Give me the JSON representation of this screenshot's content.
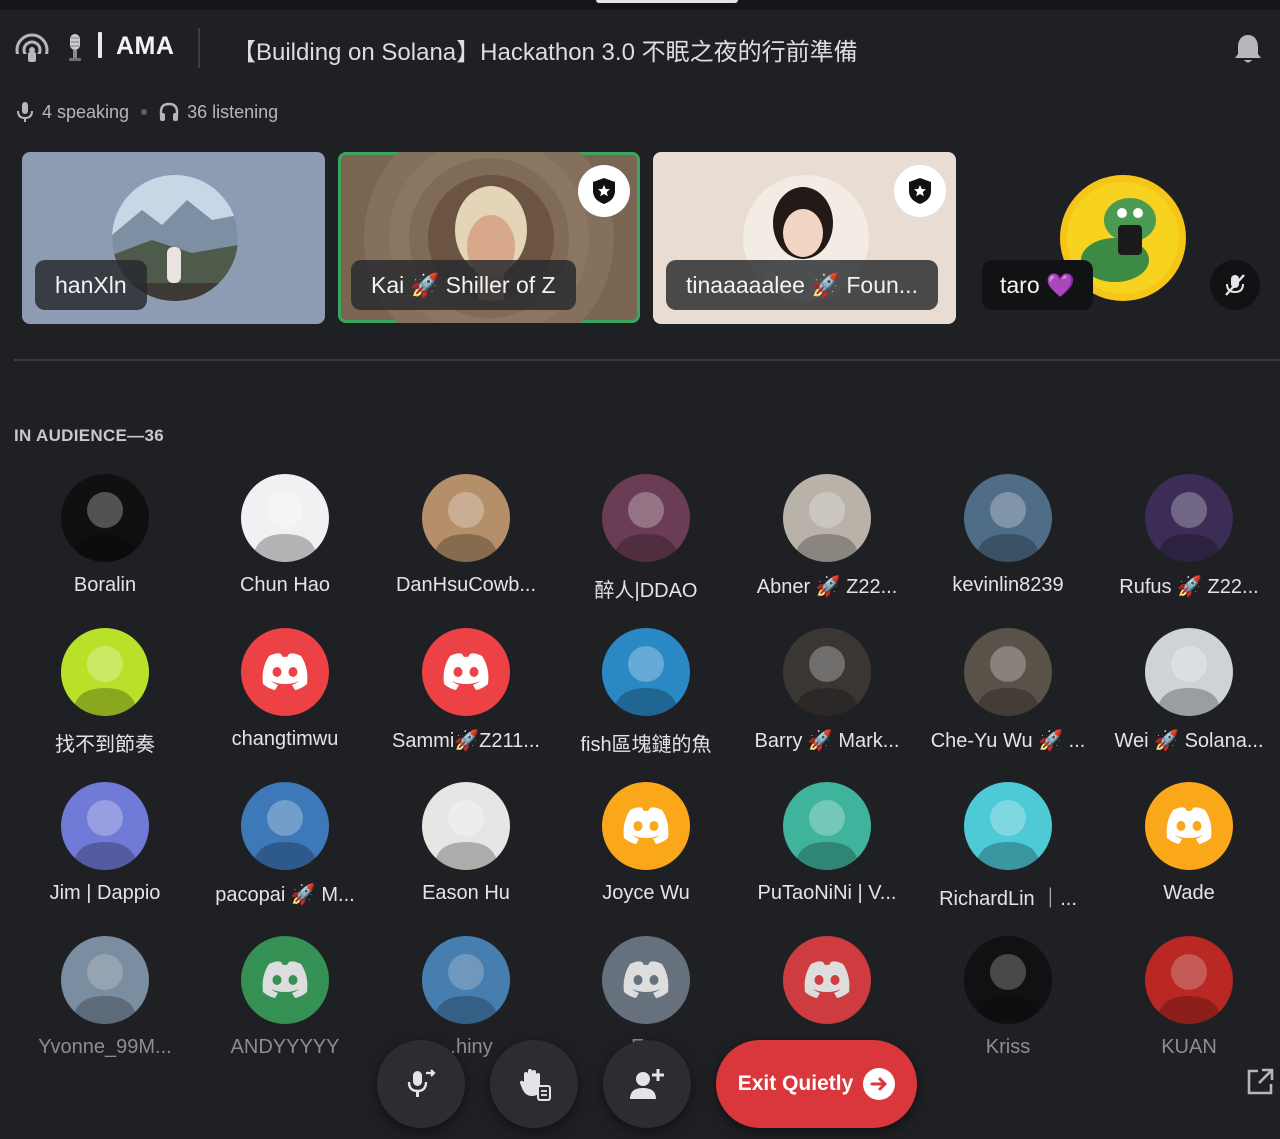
{
  "header": {
    "channel_prefix": "🎙",
    "channel_name": "AMA",
    "topic": "【Building on Solana】Hackathon 3.0 不眠之夜的行前準備"
  },
  "stats": {
    "speaking": "4 speaking",
    "listening": "36 listening"
  },
  "speakers": [
    {
      "name": "hanXln",
      "bg": "#8d9cb3",
      "moderator": false
    },
    {
      "name": "Kai 🚀 Shiller of Z",
      "bg": "#7a6552",
      "moderator": true,
      "speaking": true
    },
    {
      "name": "tinaaaaalee 🚀 Foun...",
      "bg": "#e8dcd3",
      "moderator": true
    },
    {
      "name": "taro 💜",
      "moderator": false,
      "muted": true
    }
  ],
  "audience_title": "IN AUDIENCE—36",
  "audience": [
    {
      "name": "Boralin",
      "bg": "#101010",
      "icon": "avatar"
    },
    {
      "name": "Chun Hao",
      "bg": "#f1f1f4",
      "icon": "avatar"
    },
    {
      "name": "DanHsuCowb...",
      "bg": "#b58f6a",
      "icon": "avatar"
    },
    {
      "name": "醉人|DDAO",
      "bg": "#6b3d55",
      "icon": "avatar"
    },
    {
      "name": "Abner 🚀 Z22...",
      "bg": "#b8b2a8",
      "icon": "avatar"
    },
    {
      "name": "kevinlin8239",
      "bg": "#4f6d86",
      "icon": "avatar"
    },
    {
      "name": "Rufus 🚀 Z22...",
      "bg": "#3b2d55",
      "icon": "avatar"
    },
    {
      "name": "找不到節奏",
      "bg": "#b9e12a",
      "icon": "avatar"
    },
    {
      "name": "changtimwu",
      "bg": "#ed4245",
      "icon": "discord"
    },
    {
      "name": "Sammi🚀Z211...",
      "bg": "#ed4245",
      "icon": "discord"
    },
    {
      "name": "fish區塊鏈的魚",
      "bg": "#2a89c4",
      "icon": "avatar"
    },
    {
      "name": "Barry 🚀 Mark...",
      "bg": "#3a3634",
      "icon": "avatar"
    },
    {
      "name": "Che-Yu Wu 🚀 ...",
      "bg": "#5a5248",
      "icon": "avatar"
    },
    {
      "name": "Wei 🚀 Solana...",
      "bg": "#cfd3d6",
      "icon": "avatar"
    },
    {
      "name": "Jim | Dappio",
      "bg": "#6f7bd6",
      "icon": "avatar"
    },
    {
      "name": "pacopai 🚀 M...",
      "bg": "#3d78b8",
      "icon": "avatar"
    },
    {
      "name": "Eason Hu",
      "bg": "#e6e6e4",
      "icon": "avatar"
    },
    {
      "name": "Joyce Wu",
      "bg": "#faa81a",
      "icon": "discord"
    },
    {
      "name": "PuTaoNiNi | V...",
      "bg": "#3fb39b",
      "icon": "avatar"
    },
    {
      "name": "RichardLin ｜...",
      "bg": "#4ec9d6",
      "icon": "avatar"
    },
    {
      "name": "Wade",
      "bg": "#faa81a",
      "icon": "discord"
    },
    {
      "name": "Yvonne_99M...",
      "bg": "#8aa0b7",
      "icon": "avatar"
    },
    {
      "name": "ANDYYYYY",
      "bg": "#3ba55d",
      "icon": "discord"
    },
    {
      "name": "...hiny",
      "bg": "#4d8fc8",
      "icon": "avatar"
    },
    {
      "name": "E...",
      "bg": "#747f8d",
      "icon": "discord"
    },
    {
      "name": "",
      "bg": "#ed4245",
      "icon": "discord"
    },
    {
      "name": "Kriss",
      "bg": "#0e0f10",
      "icon": "avatar"
    },
    {
      "name": "KUAN",
      "bg": "#d42a22",
      "icon": "avatar"
    }
  ],
  "controls": {
    "exit_label": "Exit Quietly"
  },
  "colors": {
    "accent_red": "#da373c",
    "speaking_green": "#3ba55d",
    "background": "#1f2023"
  }
}
